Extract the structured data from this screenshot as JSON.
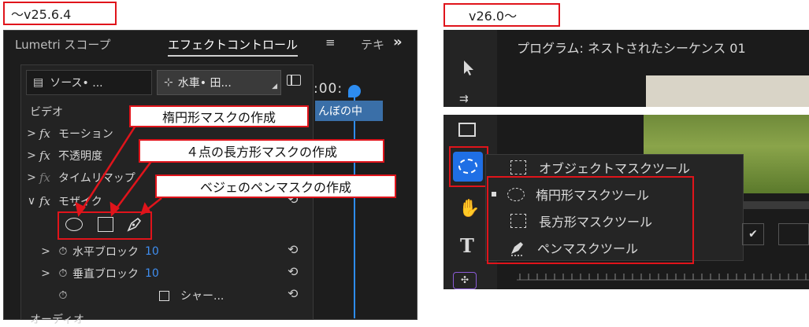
{
  "labels": {
    "left_version": "～v25.6.4",
    "right_version": "v26.0～"
  },
  "callouts": {
    "ellipse": "楕円形マスクの作成",
    "rect": "４点の長方形マスクの作成",
    "pen": "ベジェのペンマスクの作成"
  },
  "left_panel": {
    "tabs": [
      "Lumetri スコープ",
      "エフェクトコントロール",
      "テキ"
    ],
    "menu_glyph": "≡",
    "more_glyph": "»",
    "source_label": "ソース• ...",
    "sequence_label": "水車• 田...",
    "timecode": ":00:",
    "clip_label": "んぼの中",
    "section_video": "ビデオ",
    "section_audio": "オーディオ",
    "effects": [
      {
        "name": "モーション"
      },
      {
        "name": "不透明度"
      },
      {
        "name": "タイムリマップ"
      },
      {
        "name": "モザイク"
      }
    ],
    "params": [
      {
        "name": "水平ブロック",
        "value": "10"
      },
      {
        "name": "垂直ブロック",
        "value": "10"
      },
      {
        "name": "シャー..."
      }
    ]
  },
  "right_panel": {
    "program_title": "プログラム: ネストされたシーケンス 01",
    "flyout": [
      {
        "label": "オブジェクトマスクツール",
        "selected": false
      },
      {
        "label": "楕円形マスクツール",
        "selected": true
      },
      {
        "label": "長方形マスクツール",
        "selected": false
      },
      {
        "label": "ペンマスクツール",
        "selected": false
      }
    ]
  },
  "colors": {
    "accent_red": "#e0141b",
    "accent_blue": "#2d8cf0",
    "panel_bg": "#1f1f1f"
  }
}
